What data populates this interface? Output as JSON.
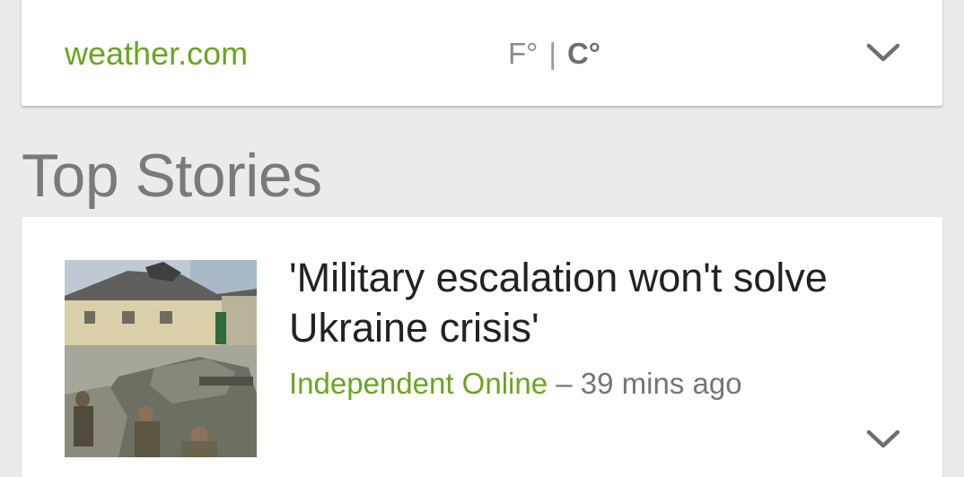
{
  "weather": {
    "source_link": "weather.com",
    "unit_f": "F°",
    "separator": "|",
    "unit_c": "C°",
    "expand_icon": "chevron-down-icon"
  },
  "top_stories": {
    "title": "Top Stories",
    "stories": [
      {
        "headline": "'Military escalation won't solve Ukraine crisis'",
        "source": "Independent Online",
        "separator": "–",
        "time": "39 mins ago",
        "expand_icon": "chevron-down-icon"
      }
    ]
  },
  "colors": {
    "background": "#ebebeb",
    "card": "#ffffff",
    "accent_green": "#6aa520",
    "headline_text": "#222222",
    "secondary_text": "#757575",
    "section_title": "#7a7a7a"
  }
}
